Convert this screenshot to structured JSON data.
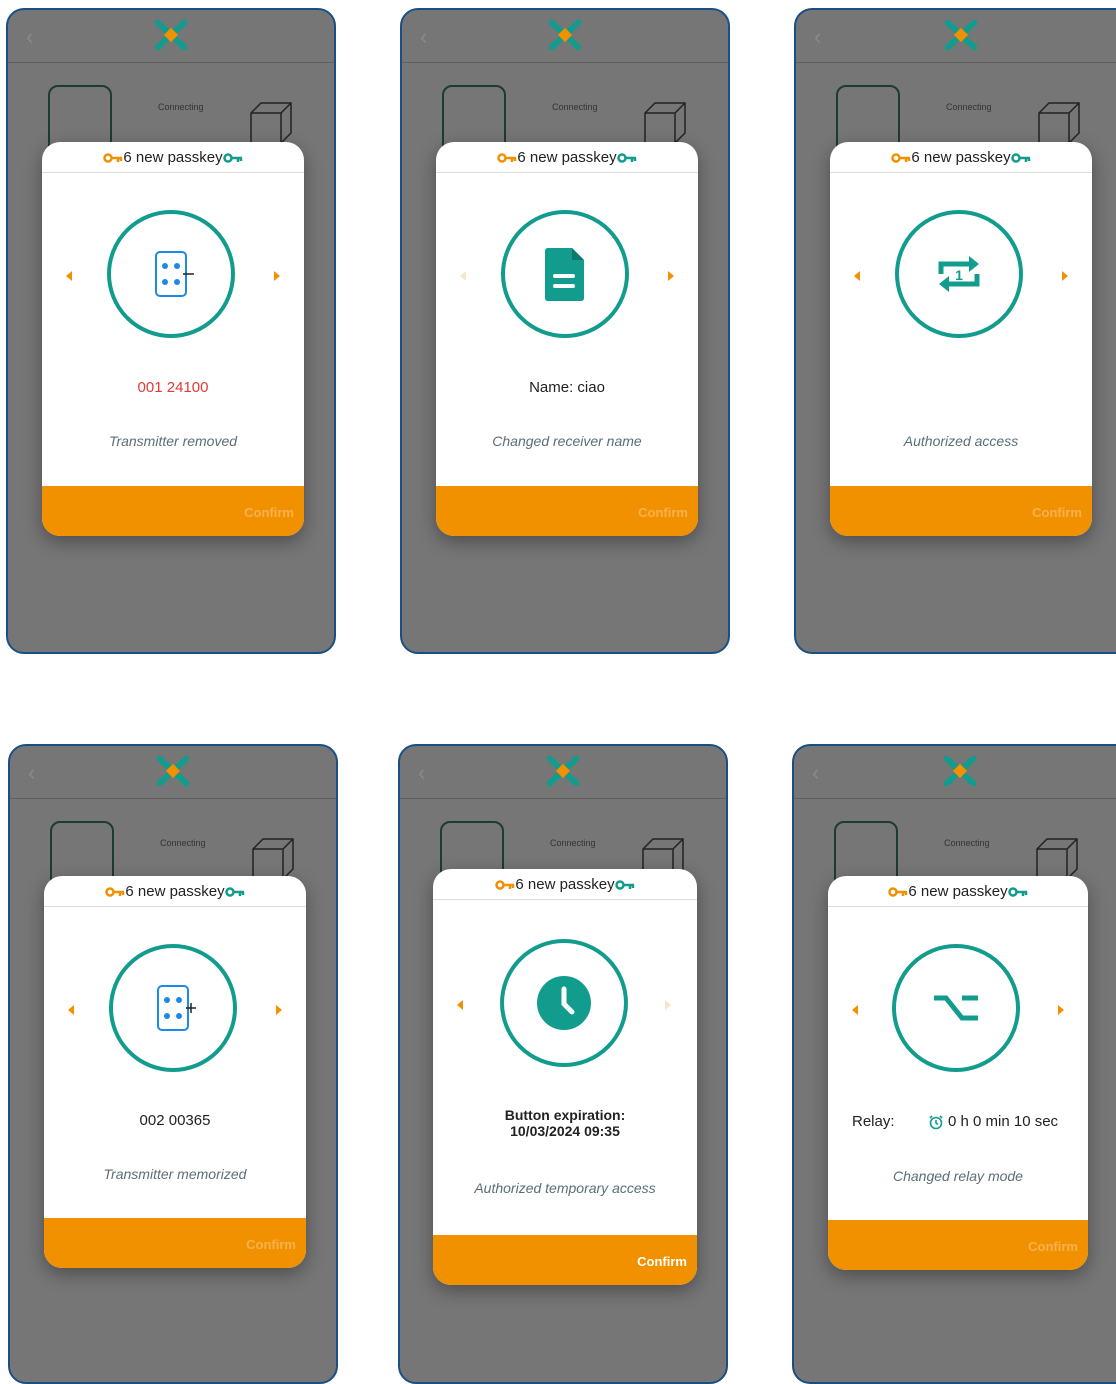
{
  "title": "6 new passkey",
  "connecting": "Connecting",
  "confirm": "Confirm",
  "colors": {
    "teal": "#129c8e",
    "orange": "#f29100",
    "frame": "#1a4f86",
    "red": "#e53935"
  },
  "panels": [
    {
      "icon": "transmitter-remove-icon",
      "info": "001 24100",
      "caption": "Transmitter removed"
    },
    {
      "icon": "document-icon",
      "info": "Name: ciao",
      "caption": "Changed receiver name"
    },
    {
      "icon": "repeat-one-icon",
      "info": "",
      "caption": "Authorized access"
    },
    {
      "icon": "transmitter-add-icon",
      "info": "002 00365",
      "caption": "Transmitter memorized"
    },
    {
      "icon": "clock-icon",
      "info_line1": "Button expiration:",
      "info_line2": "10/03/2024 09:35",
      "caption": "Authorized temporary access"
    },
    {
      "icon": "relay-switch-icon",
      "relay_label": "Relay:",
      "relay_value": "0 h 0 min 10 sec",
      "caption": "Changed relay mode"
    }
  ]
}
